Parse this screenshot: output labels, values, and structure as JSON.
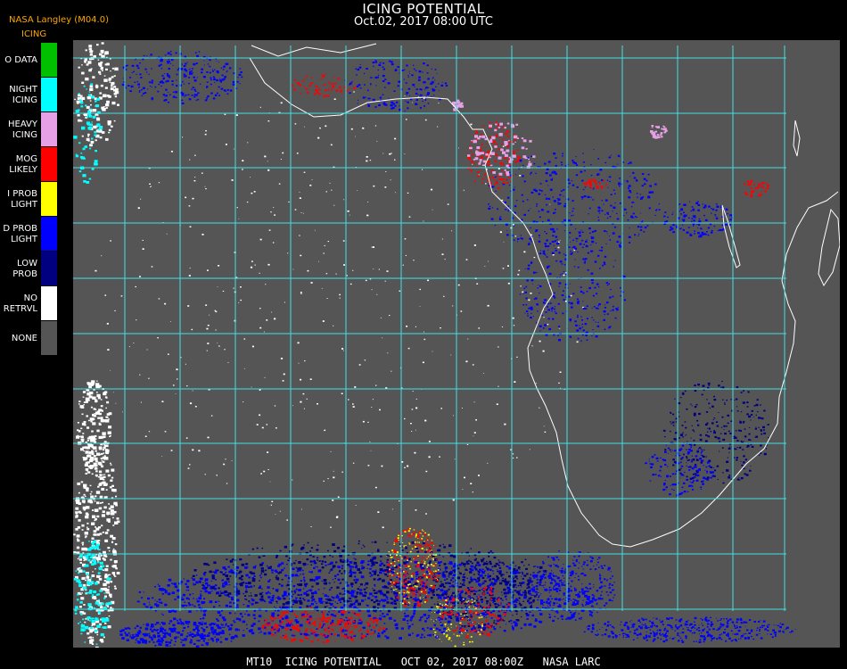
{
  "header": {
    "title": "ICING POTENTIAL",
    "subtitle": "Oct.02, 2017 08:00 UTC",
    "source": "NASA Langley (M04.0)",
    "product": "ICING"
  },
  "legend": {
    "items": [
      {
        "label": "O DATA",
        "color": "#00c000"
      },
      {
        "label": "NIGHT\nICING",
        "color": "#00ffff"
      },
      {
        "label": "HEAVY\nICING",
        "color": "#e6a0e6"
      },
      {
        "label": "MOG\nLIKELY",
        "color": "#ff0000"
      },
      {
        "label": "I PROB\nLIGHT",
        "color": "#ffff00"
      },
      {
        "label": "D PROB\nLIGHT",
        "color": "#0000ff"
      },
      {
        "label": "LOW\nPROB",
        "color": "#000080"
      },
      {
        "label": "NO\nRETRVL",
        "color": "#ffffff"
      },
      {
        "label": "NONE",
        "color": "#555555"
      }
    ]
  },
  "map": {
    "background_color": "#555555",
    "grid_color": "#40e0e8",
    "coastline_color": "#ffffff",
    "grid_label_color": "#ff2020"
  },
  "footer": {
    "text": "MT10  ICING POTENTIAL   OCT 02, 2017 08:00Z   NASA LARC"
  }
}
